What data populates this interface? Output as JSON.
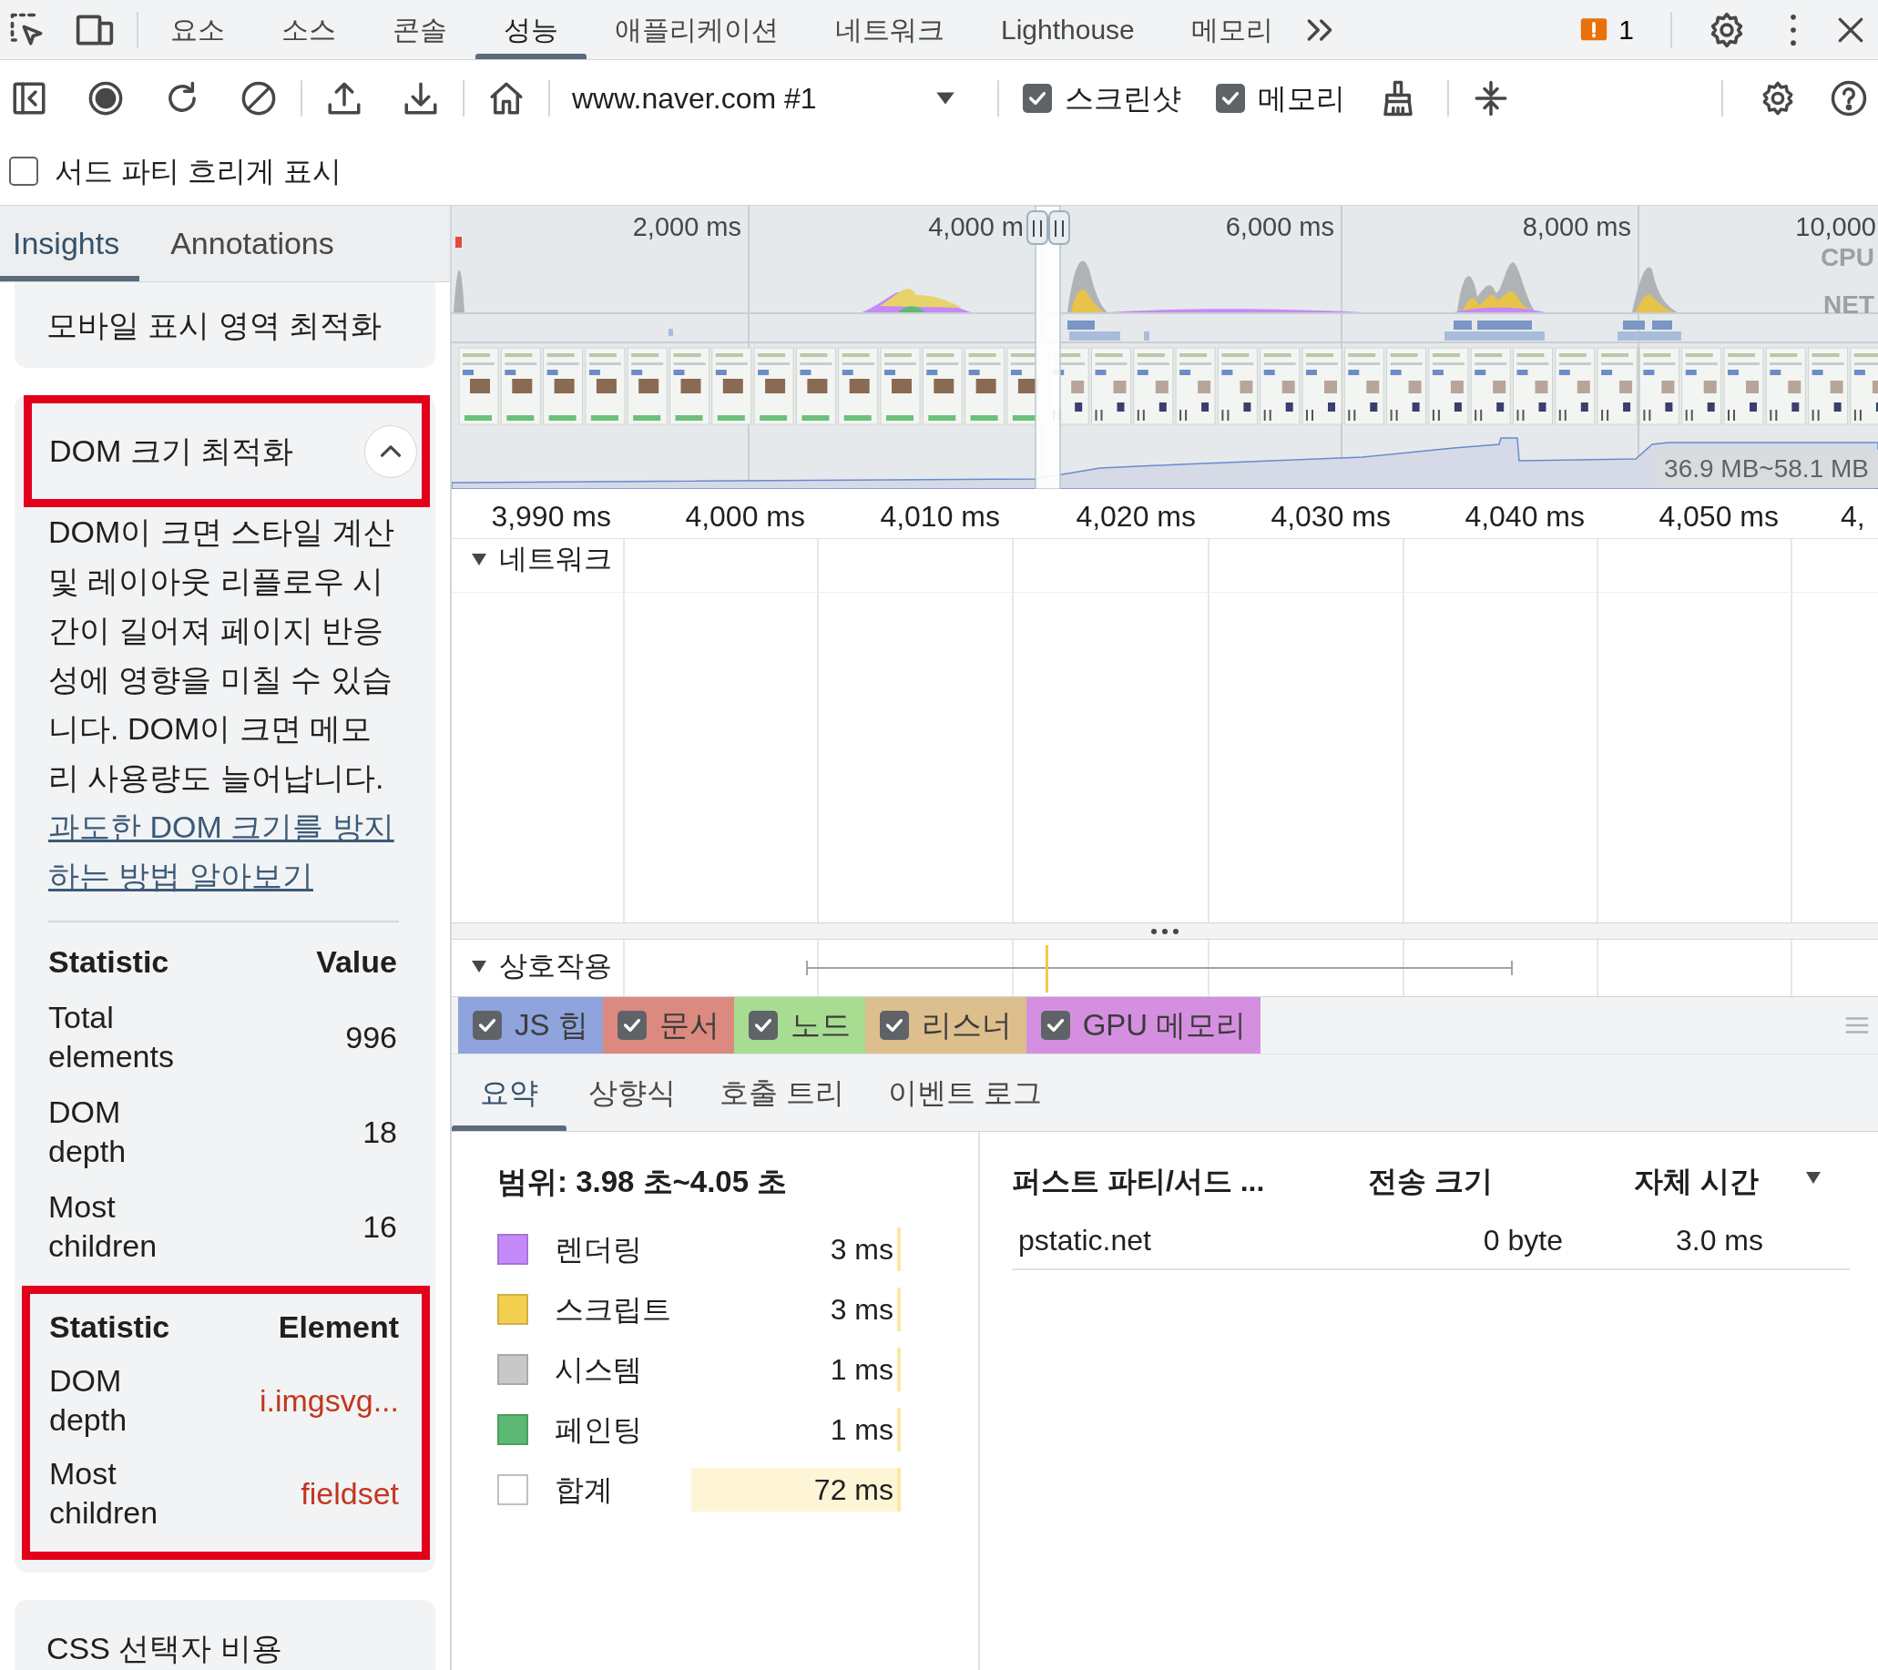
{
  "top_tabs": [
    {
      "label": "요소",
      "selected": false
    },
    {
      "label": "소스",
      "selected": false
    },
    {
      "label": "콘솔",
      "selected": false
    },
    {
      "label": "성능",
      "selected": true
    },
    {
      "label": "애플리케이션",
      "selected": false
    },
    {
      "label": "네트워크",
      "selected": false
    },
    {
      "label": "Lighthouse",
      "selected": false
    },
    {
      "label": "메모리",
      "selected": false
    }
  ],
  "issues_count": "1",
  "recording_target": "www.naver.com #1",
  "capture_options": [
    {
      "label": "스크린샷",
      "checked": true
    },
    {
      "label": "메모리",
      "checked": true
    }
  ],
  "dim_third_parties": {
    "label": "서드 파티 흐리게 표시",
    "checked": false
  },
  "sidebar": {
    "tabs": [
      {
        "label": "Insights",
        "selected": true
      },
      {
        "label": "Annotations",
        "selected": false
      }
    ],
    "insights": [
      {
        "title": "모바일 표시 영역 최적화"
      },
      {
        "title": "DOM 크기 최적화",
        "expanded": true,
        "highlighted": true,
        "description": "DOM이 크면 스타일 계산 및 레이아웃 리플로우 시간이 길어져 페이지 반응성에 영향을 미칠 수 있습니다. DOM이 크면 메모리 사용량도 늘어납니다.",
        "link": "과도한 DOM 크기를 방지하는 방법 알아보기",
        "stats_table": {
          "columns": [
            "Statistic",
            "Value"
          ],
          "rows": [
            [
              "Total elements",
              "996"
            ],
            [
              "DOM depth",
              "18"
            ],
            [
              "Most children",
              "16"
            ]
          ]
        },
        "elements_table": {
          "highlighted": true,
          "columns": [
            "Statistic",
            "Element"
          ],
          "rows": [
            [
              "DOM depth",
              "i.imgsvg..."
            ],
            [
              "Most children",
              "fieldset"
            ]
          ]
        }
      },
      {
        "title": "CSS 선택자 비용"
      }
    ]
  },
  "overview": {
    "time_labels": [
      "2,000 ms",
      "4,000 m",
      "6,000 ms",
      "8,000 ms",
      "10,000"
    ],
    "track_labels": [
      "CPU",
      "NET"
    ],
    "memory_range": "36.9 MB~58.1 MB"
  },
  "ruler": [
    "3,990 ms",
    "4,000 ms",
    "4,010 ms",
    "4,020 ms",
    "4,030 ms",
    "4,040 ms",
    "4,050 ms",
    "4,"
  ],
  "tracks": [
    {
      "label": "네트워크",
      "expanded": true
    },
    {
      "label": "상호작용",
      "expanded": true
    }
  ],
  "memory_counters": [
    {
      "label": "JS 힙",
      "checked": true,
      "color": "#8fa3dc"
    },
    {
      "label": "문서",
      "checked": true,
      "color": "#dc8a80"
    },
    {
      "label": "노드",
      "checked": true,
      "color": "#a8dc90"
    },
    {
      "label": "리스너",
      "checked": true,
      "color": "#ddbf8e"
    },
    {
      "label": "GPU 메모리",
      "checked": true,
      "color": "#d58fe0"
    }
  ],
  "details_tabs": [
    {
      "label": "요약",
      "selected": true
    },
    {
      "label": "상향식",
      "selected": false
    },
    {
      "label": "호출 트리",
      "selected": false
    },
    {
      "label": "이벤트 로그",
      "selected": false
    }
  ],
  "summary": {
    "range": "범위: 3.98 초~4.05 초",
    "categories": [
      {
        "kind": "category",
        "label": "렌더링",
        "value": "3 ms",
        "color": "#c58af9"
      },
      {
        "kind": "category",
        "label": "스크립트",
        "value": "3 ms",
        "color": "#f4cf4f"
      },
      {
        "kind": "category",
        "label": "시스템",
        "value": "1 ms",
        "color": "#c8c8c8"
      },
      {
        "kind": "category",
        "label": "페인팅",
        "value": "1 ms",
        "color": "#5bb974"
      },
      {
        "kind": "total",
        "label": "합계",
        "value": "72 ms"
      }
    ]
  },
  "third_party_table": {
    "columns": [
      "퍼스트 파티/서드 ...",
      "전송 크기",
      "자체 시간"
    ],
    "rows": [
      [
        "pstatic.net",
        "0 byte",
        "3.0 ms"
      ]
    ]
  }
}
